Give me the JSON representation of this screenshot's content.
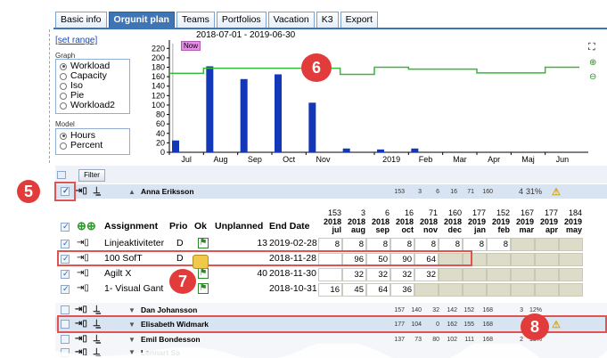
{
  "tabs": [
    {
      "label": "Basic info",
      "active": false
    },
    {
      "label": "Orgunit plan",
      "active": true
    },
    {
      "label": "Teams",
      "active": false
    },
    {
      "label": "Portfolios",
      "active": false
    },
    {
      "label": "Vacation",
      "active": false
    },
    {
      "label": "K3",
      "active": false
    },
    {
      "label": "Export",
      "active": false
    }
  ],
  "left_panel": {
    "set_range": "[set range]",
    "graph_label": "Graph",
    "graph_options": [
      "Workload",
      "Capacity",
      "Iso",
      "Pie",
      "Workload2"
    ],
    "graph_selected": "Workload",
    "model_label": "Model",
    "model_options": [
      "Hours",
      "Percent"
    ],
    "model_selected": "Hours"
  },
  "chart_data": {
    "type": "bar",
    "title": "2018-07-01 - 2019-06-30",
    "now_label": "Now",
    "x_tick_labels": [
      "Jul",
      "Aug",
      "Sep",
      "Oct",
      "Nov",
      "2019",
      "Feb",
      "Mar",
      "Apr",
      "Maj",
      "Jun"
    ],
    "y_ticks": [
      0,
      20,
      40,
      60,
      80,
      100,
      120,
      140,
      160,
      180,
      200,
      220
    ],
    "ylim": [
      0,
      230
    ],
    "bar_color": "#1238b8",
    "line_color": "#38b838",
    "bars": [
      {
        "month": "Jul",
        "value": 25
      },
      {
        "month": "Aug",
        "value": 182
      },
      {
        "month": "Sep",
        "value": 155
      },
      {
        "month": "Oct",
        "value": 165
      },
      {
        "month": "Nov",
        "value": 105
      },
      {
        "month": "Dec",
        "value": 8
      },
      {
        "month": "2019",
        "value": 6
      },
      {
        "month": "Feb",
        "value": 8
      }
    ],
    "capacity_line": [
      {
        "month": "Jul",
        "value": 167
      },
      {
        "month": "Aug",
        "value": 178
      },
      {
        "month": "Sep",
        "value": 178
      },
      {
        "month": "Oct",
        "value": 178
      },
      {
        "month": "Nov",
        "value": 178
      },
      {
        "month": "Dec",
        "value": 165
      },
      {
        "month": "2019",
        "value": 180
      },
      {
        "month": "Feb",
        "value": 176
      },
      {
        "month": "Mar",
        "value": 176
      },
      {
        "month": "Apr",
        "value": 168
      },
      {
        "month": "Maj",
        "value": 168
      },
      {
        "month": "Jun",
        "value": 180
      }
    ]
  },
  "filter_button": "Filter",
  "persons": [
    {
      "name": "Anna Eriksson",
      "stats": [
        "153",
        "3",
        "6",
        "16",
        "71",
        "160",
        "4",
        "31%"
      ]
    },
    {
      "name": "Dan Johansson",
      "stats": [
        "157",
        "140",
        "32",
        "142",
        "152",
        "168",
        "3",
        "12%"
      ]
    },
    {
      "name": "Elisabeth Widmark",
      "stats": [
        "177",
        "104",
        "0",
        "162",
        "155",
        "168",
        "",
        "8%"
      ]
    },
    {
      "name": "Emil Bondesson",
      "stats": [
        "137",
        "73",
        "80",
        "102",
        "111",
        "168",
        "2",
        "18%"
      ]
    },
    {
      "name": "Lennart Sa",
      "stats": []
    }
  ],
  "assignment_table": {
    "headers": {
      "assignment": "Assignment",
      "prio": "Prio",
      "ok": "Ok",
      "unplanned": "Unplanned",
      "end_date": "End Date"
    },
    "month_totals": [
      "153",
      "3",
      "6",
      "16",
      "71",
      "160",
      "177",
      "152",
      "167",
      "177",
      "184"
    ],
    "month_years": [
      "2018",
      "2018",
      "2018",
      "2018",
      "2018",
      "2018",
      "2019",
      "2019",
      "2019",
      "2019",
      "2019"
    ],
    "month_names": [
      "jul",
      "aug",
      "sep",
      "oct",
      "nov",
      "dec",
      "jan",
      "feb",
      "mar",
      "apr",
      "may"
    ],
    "rows": [
      {
        "assignment": "Linjeaktiviteter",
        "prio": "D",
        "unplanned": "13",
        "end_date": "2019-02-28",
        "values": [
          "8",
          "8",
          "8",
          "8",
          "8",
          "8",
          "8",
          "8"
        ]
      },
      {
        "assignment": "100 SofT",
        "prio": "D",
        "unplanned": "",
        "end_date": "2018-11-28",
        "values": [
          "",
          "96",
          "50",
          "90",
          "64"
        ]
      },
      {
        "assignment": "Agilt X",
        "prio": "D",
        "unplanned": "40",
        "end_date": "2018-11-30",
        "values": [
          "",
          "32",
          "32",
          "32",
          "32"
        ]
      },
      {
        "assignment": "1- Visual Gant",
        "prio": "",
        "unplanned": "",
        "end_date": "2018-10-31",
        "values": [
          "16",
          "45",
          "64",
          "36"
        ]
      }
    ]
  },
  "callouts": [
    "5",
    "6",
    "7",
    "8"
  ]
}
